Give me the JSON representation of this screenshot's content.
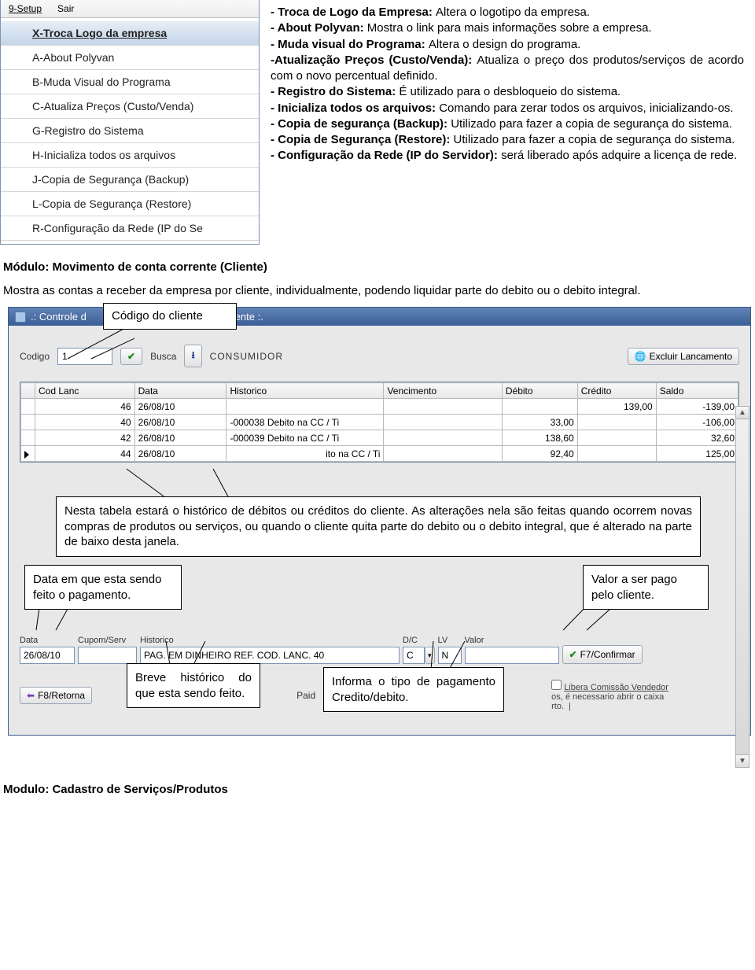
{
  "menu_bar": {
    "setup": "9-Setup",
    "sair": "Sair"
  },
  "menu_items": [
    "X-Troca Logo da empresa",
    "A-About Polyvan",
    "B-Muda Visual do Programa",
    "C-Atualiza Preços (Custo/Venda)",
    "G-Registro do Sistema",
    "H-Inicializa todos os arquivos",
    "J-Copia de Segurança (Backup)",
    "L-Copia de Segurança (Restore)",
    "R-Configuração da Rede (IP do Se"
  ],
  "desc": {
    "l1a": "- Troca de Logo da Empresa: ",
    "l1b": "Altera o logotipo da empresa.",
    "l2a": "- About Polyvan: ",
    "l2b": "Mostra o link para mais informações sobre a empresa.",
    "l3a": "- Muda visual do Programa: ",
    "l3b": "Altera o design do programa.",
    "l4a": "-Atualização Preços (Custo/Venda): ",
    "l4b": "Atualiza o preço dos produtos/serviços de acordo com o novo percentual definido.",
    "l5a": "- Registro do Sistema: ",
    "l5b": "É utilizado para o desbloqueio do sistema.",
    "l6a": "- Inicializa todos os arquivos: ",
    "l6b": "Comando para zerar todos os arquivos, inicializando-os.",
    "l7a": "- Copia de segurança (Backup): ",
    "l7b": "Utilizado para fazer a copia de segurança do sistema.",
    "l8a": "- Copia de Segurança (Restore): ",
    "l8b": "Utilizado para fazer a copia de segurança do sistema.",
    "l9a": "- Configuração da Rede (IP do Servidor): ",
    "l9b": "será liberado após adquire a licença de rede."
  },
  "section1_title": "Módulo: Movimento de conta corrente (Cliente)",
  "section1_body": "Mostra as contas a receber da empresa por cliente, individualmente, podendo liquidar parte do debito ou o debito integral.",
  "app": {
    "title_prefix": ".: Controle d",
    "title_suffix": "um Cliente :.",
    "callout_codigo": "Código do cliente",
    "codigo_label": "Codigo",
    "codigo_value": "1",
    "busca_label": "Busca",
    "cliente_nome": "CONSUMIDOR",
    "btn_excluir": "Excluir Lancamento",
    "cols": [
      "Cod Lanc",
      "Data",
      "Historico",
      "Vencimento",
      "Débito",
      "Crédito",
      "Saldo"
    ],
    "rows": [
      {
        "cod": "46",
        "data": "26/08/10",
        "hist": "",
        "venc": "",
        "deb": "",
        "cred": "139,00",
        "saldo": "-139,00"
      },
      {
        "cod": "40",
        "data": "26/08/10",
        "hist": "-000038 Debito na CC / Ti",
        "venc": "",
        "deb": "33,00",
        "cred": "",
        "saldo": "-106,00"
      },
      {
        "cod": "42",
        "data": "26/08/10",
        "hist": "-000039 Debito na CC / Ti",
        "venc": "",
        "deb": "138,60",
        "cred": "",
        "saldo": "32,60"
      },
      {
        "cod": "44",
        "data": "26/08/10",
        "hist": "ito na CC / Ti",
        "venc": "",
        "deb": "92,40",
        "cred": "",
        "saldo": "125,00"
      }
    ],
    "callout_tabela": "Nesta tabela estará o histórico de débitos ou créditos do cliente. As alterações nela são feitas quando ocorrem novas compras de produtos ou serviços, ou quando o cliente quita parte do debito ou o debito integral, que é alterado na parte de baixo desta janela.",
    "callout_data": "Data em que esta sendo feito o pagamento.",
    "callout_valor": "Valor a ser pago pelo cliente.",
    "callout_hist": "Breve histórico do que esta sendo feito.",
    "callout_dc": "Informa o tipo de pagamento Credito/debito.",
    "form": {
      "data_lbl": "Data",
      "data_val": "26/08/10",
      "cupom_lbl": "Cupom/Serv",
      "hist_lbl": "Historico",
      "hist_val": "PAG. EM DINHEIRO REF. COD. LANC. 40",
      "dc_lbl": "D/C",
      "dc_val": "C",
      "lv_lbl": "LV",
      "lv_val": "N",
      "valor_lbl": "Valor",
      "confirmar": "F7/Confirmar"
    },
    "btn_retorna": "F8/Retorna",
    "checkbox_libera": "Libera Comissão Vendedor",
    "note1": "os, é necessario abrir o caixa",
    "note2": "rto.",
    "paid_lbl": "Paid"
  },
  "section2_title": "Modulo: Cadastro de Serviços/Produtos"
}
